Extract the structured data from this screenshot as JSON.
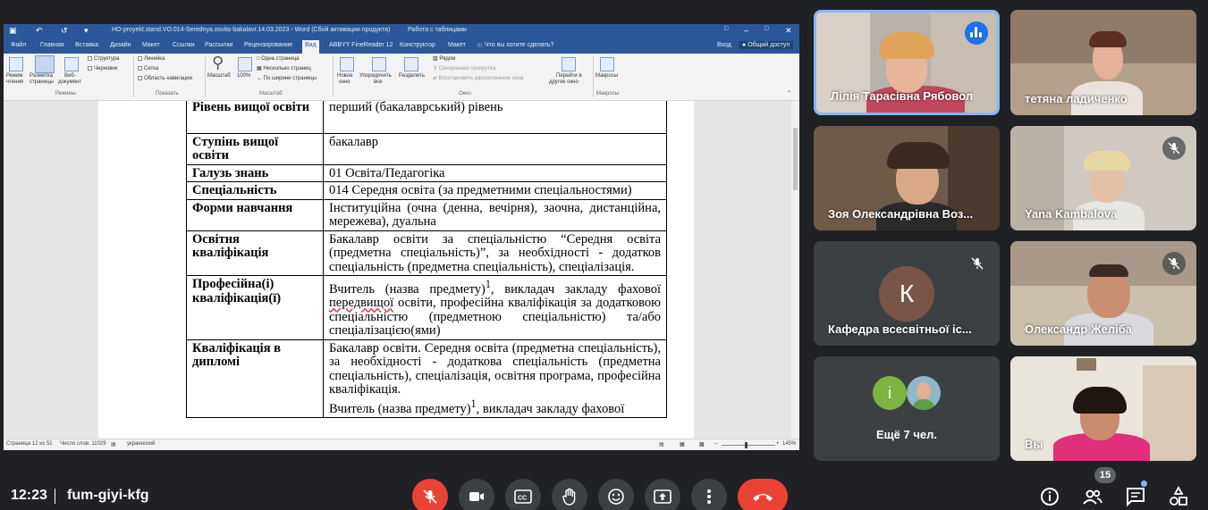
{
  "word": {
    "title": "НО-proyekt.stand.VO.014-Serednya.osvita-bakalavr.14.03.2023 - Word (Сбой активации продукта)",
    "context_title": "Работа с таблицами",
    "sign_in": "Вход",
    "share": "Общий доступ",
    "tabs": [
      "Файл",
      "Главная",
      "Вставка",
      "Дизайн",
      "Макет",
      "Ссылки",
      "Рассылки",
      "Рецензирование",
      "Вид",
      "ABBYY FineReader 12",
      "Конструктор",
      "Макет"
    ],
    "tell_me": "Что вы хотите сделать?",
    "ribbon": {
      "btn_read_mode_1": "Режим",
      "btn_read_mode_2": "чтения",
      "btn_print_layout_1": "Разметка",
      "btn_print_layout_2": "страницы",
      "btn_web_1": "Веб-",
      "btn_web_2": "документ",
      "cb_structure": "Структура",
      "cb_draft": "Черновик",
      "cb_ruler": "Линейка",
      "cb_grid": "Сетка",
      "cb_nav": "Область навигации",
      "btn_zoom": "Масштаб",
      "btn_100": "100%",
      "one_page": "Одна страница",
      "multi_page": "Несколько страниц",
      "page_width": "По ширине страницы",
      "new_window_1": "Новое",
      "new_window_2": "окно",
      "arrange_1": "Упорядочить",
      "arrange_2": "все",
      "split": "Разделить",
      "side_by_side": "Рядом",
      "sync_scroll": "Синхронная прокрутка",
      "reset_pos": "Восстановить расположение окна",
      "switch_1": "Перейти в",
      "switch_2": "другое окно",
      "macros_1": "Макросы",
      "group_modes": "Режимы",
      "group_show": "Показать",
      "group_zoom": "Масштаб",
      "group_window": "Окно",
      "group_macros": "Макросы"
    },
    "status": {
      "page": "Страница 12 из 51",
      "words": "Число слов: 11029",
      "lang": "украинский",
      "zoom": "145%"
    },
    "table": {
      "r1k": "Рівень вищої освіти",
      "r1v": "перший (бакалаврський) рівень",
      "r2k": "Ступінь вищої освіти",
      "r2v": "бакалавр",
      "r3k": "Галузь знань",
      "r3v": "01 Освіта/Педагогіка",
      "r4k": "Спеціальність",
      "r4v": "014 Середня освіта (за предметними спеціальностями)",
      "r5k": "Форми навчання",
      "r5v": "Інституційна (очна (денна, вечірня), заочна, дистанційна, мережева), дуальна",
      "r6k": "Освітня кваліфікація",
      "r6v": "Бакалавр освіти за спеціальністю “Середня освіта (предметна спеціальність)”, за необхідності - додатков спеціальність (предметна спеціальність), спеціалізація.",
      "r7k": "Професійна(і) кваліфікація(ї)",
      "r7v_a": "Вчитель (назва предмету)",
      "r7v_sup": "1",
      "r7v_b": ", викладач закладу фахової ",
      "r7v_c": "передвищої",
      "r7v_d": " освіти, професійна кваліфікація за додатковою спеціальністю (предметною спеціальністю) та/або спеціалізацією(ями)",
      "r8k": "Кваліфікація в дипломі",
      "r8v": "Бакалавр освіти. Середня освіта (предметна спеціальність), за необхідності - додаткова спеціальність (предметна спеціальність), спеціалізація, освітня програма, професійна кваліфікація.",
      "r8v2_a": "Вчитель (назва предмету)",
      "r8v2_sup": "1",
      "r8v2_b": ", викладач закладу фахової"
    }
  },
  "participants": [
    {
      "name": "Лілія Тарасівна Рябовол"
    },
    {
      "name": "тетяна ладиченко"
    },
    {
      "name": "Зоя Олександрівна Воз..."
    },
    {
      "name": "Yana Kambalova"
    },
    {
      "name": "Кафедра всесвітньої іс...",
      "initial": "К"
    },
    {
      "name": "Олександр Желіба"
    },
    {
      "name": "Ещё 7 чел.",
      "initial": "i"
    },
    {
      "name": "Вы"
    }
  ],
  "meeting": {
    "time": "12:23",
    "code": "fum-giyi-kfg",
    "people_count": "15"
  },
  "colors": {
    "word_blue": "#2b579a",
    "meet_bg": "#202124",
    "tile_bg": "#3c4043",
    "active_speaker": "#8ab4f8",
    "hangup_red": "#ea4335"
  }
}
